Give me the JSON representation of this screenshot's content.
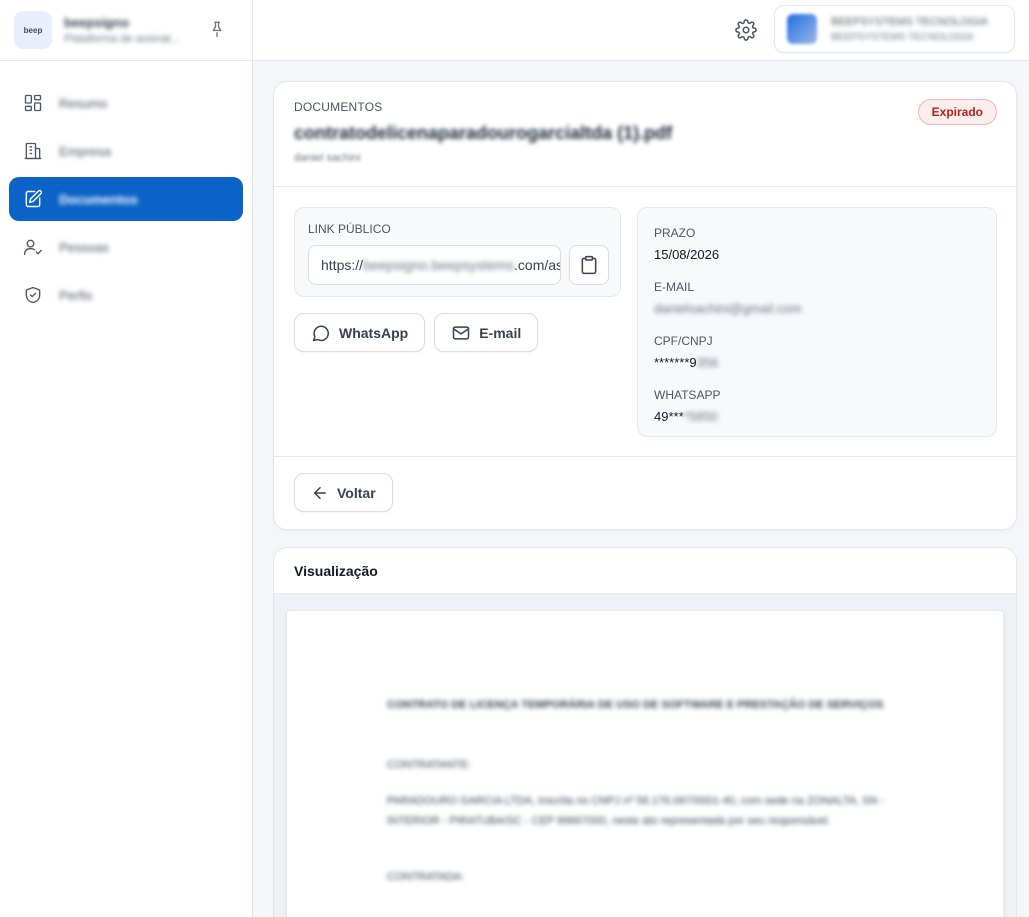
{
  "sidebar": {
    "brand": {
      "logo_text": "beep",
      "name": "beepsigno",
      "subtitle": "Plataforma de assinat..."
    },
    "items": [
      {
        "label": "Resumo",
        "icon": "dashboard-icon",
        "active": false
      },
      {
        "label": "Empresa",
        "icon": "building-icon",
        "active": false
      },
      {
        "label": "Documentos",
        "icon": "document-edit-icon",
        "active": true
      },
      {
        "label": "Pessoas",
        "icon": "user-check-icon",
        "active": false
      },
      {
        "label": "Perfis",
        "icon": "shield-icon",
        "active": false
      }
    ]
  },
  "header": {
    "account": {
      "name": "BEEPSYSTEMS TECNOLOGIA",
      "subtitle": "BEEPSYSTEMS TECNOLOGIA"
    }
  },
  "document": {
    "eyebrow": "DOCUMENTOS",
    "title": "contratodelicenaparadourogarcialtda (1).pdf",
    "owner": "daniel sachini",
    "status": "Expirado",
    "status_color": "#b42318",
    "link": {
      "label": "LINK PÚBLICO",
      "prefix": "https://",
      "host": "beepsigno.beepsystems",
      "suffix": ".com/as"
    },
    "share": {
      "whatsapp": "WhatsApp",
      "email": "E-mail"
    },
    "info": {
      "prazo_label": "PRAZO",
      "prazo_value": "15/08/2026",
      "email_label": "E-MAIL",
      "email_value": "danielsachini@gmail.com",
      "cpf_label": "CPF/CNPJ",
      "cpf_value_visible": "*******9",
      "cpf_value_hidden": "356",
      "whatsapp_label": "WHATSAPP",
      "whatsapp_value_visible": "49***",
      "whatsapp_value_hidden": "*5850"
    },
    "back_label": "Voltar"
  },
  "preview": {
    "title": "Visualização",
    "paper": {
      "heading": "CONTRATO DE LICENÇA TEMPORÁRIA DE USO DE SOFTWARE E PRESTAÇÃO DE SERVIÇOS",
      "contratante_label": "CONTRATANTE:",
      "contratante_text": "PARADOURO GARCIA LTDA, inscrita no CNPJ nº 58.176.067/0001-40, com sede na ZONALTA, SN - INTERIOR - PIRATUBA/SC - CEP 89667000, neste ato representada por seu responsável.",
      "contratada_label": "CONTRATADA:"
    }
  }
}
